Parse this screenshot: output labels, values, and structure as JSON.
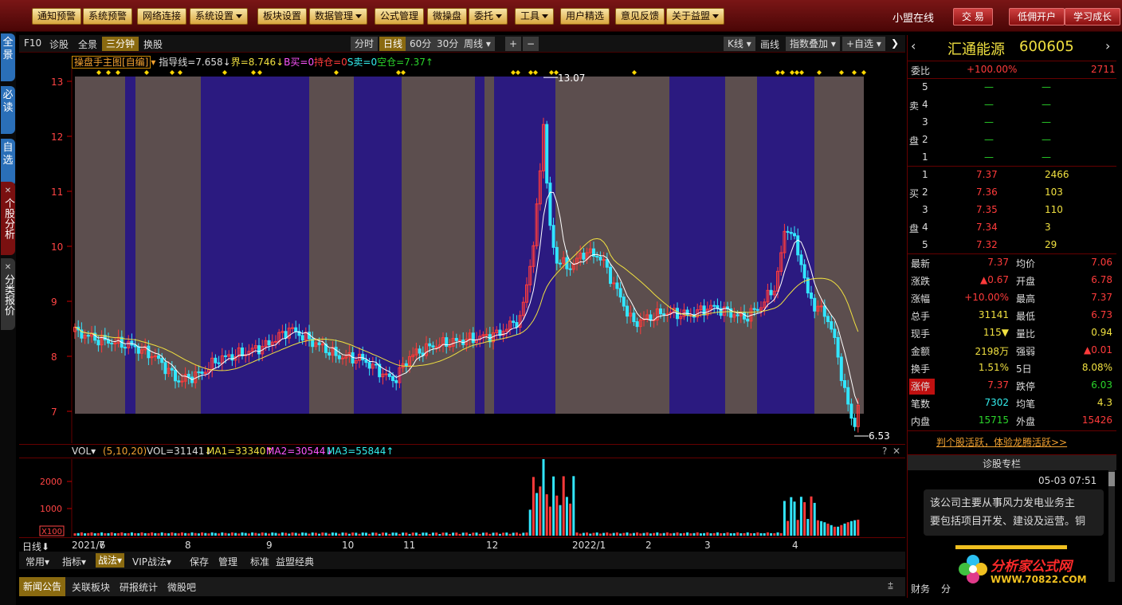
{
  "topbar": {
    "menu": [
      "通知预警",
      "系统预警",
      "网络连接",
      "系统设置",
      "板块设置",
      "数据管理",
      "公式管理",
      "微操盘",
      "委托",
      "工具",
      "用户精选",
      "意见反馈",
      "关于益盟"
    ],
    "user": "小盟在线",
    "actions": [
      "交 易",
      "低佣开户",
      "学习成长"
    ]
  },
  "lefttabs": [
    "全景",
    "必读",
    "自选",
    "个股分析",
    "分类报价"
  ],
  "toolbar": {
    "left": [
      "F10",
      "诊股",
      "全景",
      "三分钟",
      "换股"
    ],
    "periods": [
      "分时",
      "日线",
      "60分",
      "30分",
      "周线"
    ],
    "plus": "+",
    "minus": "−",
    "right": [
      "K线",
      "画线",
      "指数叠加",
      "+自选"
    ],
    "close": "❯"
  },
  "indicator": {
    "name": "操盘手主图[自编]",
    "line1": "指导线=7.658↓",
    "line2": "界=8.746↓",
    "line3": "B买=0",
    "line4": "持仓=0",
    "line5": "S卖=0",
    "line6": "空仓=7.37↑"
  },
  "chart": {
    "yticks": [
      "13",
      "12",
      "11",
      "10",
      "9",
      "8",
      "7"
    ],
    "high_label": "13.07",
    "low_label": "6.53",
    "xticks": [
      "2021/6",
      "7",
      "8",
      "9",
      "10",
      "11",
      "12",
      "2022/1",
      "2",
      "3",
      "4"
    ],
    "period_label": "日线",
    "colors": {
      "up": "#ff3b3b",
      "down": "#32e6ff",
      "band_buy": "#2b1a80",
      "band_hold": "#5c4e4e"
    }
  },
  "volume": {
    "header": "VOL",
    "params": "(5,10,20)",
    "vol": "VOL=31141↓",
    "ma1": "MA1=33340↑",
    "ma2": "MA2=30544↓",
    "ma3": "MA3=55844↑",
    "yticks": [
      "2000",
      "1000"
    ],
    "unit": "X100",
    "help": "?",
    "close": "✕"
  },
  "bottombar": [
    "常用",
    "指标",
    "战法",
    "VIP战法",
    "保存",
    "管理",
    "标准",
    "益盟经典"
  ],
  "newsbar": [
    "新闻公告",
    "关联板块",
    "研报统计",
    "微股吧"
  ],
  "stock": {
    "name": "汇通能源",
    "code": "600605",
    "weibi_label": "委比",
    "weibi": "+100.00%",
    "weicha": "2711",
    "sell_label": [
      "卖",
      "盘"
    ],
    "sells": [
      {
        "lvl": "5",
        "p": "—",
        "v": "—"
      },
      {
        "lvl": "4",
        "p": "—",
        "v": "—"
      },
      {
        "lvl": "3",
        "p": "—",
        "v": "—"
      },
      {
        "lvl": "2",
        "p": "—",
        "v": "—"
      },
      {
        "lvl": "1",
        "p": "—",
        "v": "—"
      }
    ],
    "buy_label": [
      "买",
      "盘"
    ],
    "buys": [
      {
        "lvl": "1",
        "p": "7.37",
        "v": "2466"
      },
      {
        "lvl": "2",
        "p": "7.36",
        "v": "103"
      },
      {
        "lvl": "3",
        "p": "7.35",
        "v": "110"
      },
      {
        "lvl": "4",
        "p": "7.34",
        "v": "3"
      },
      {
        "lvl": "5",
        "p": "7.32",
        "v": "29"
      }
    ],
    "quote": [
      [
        "最新",
        "7.37",
        "均价",
        "7.06"
      ],
      [
        "涨跌",
        "▲0.67",
        "开盘",
        "6.78"
      ],
      [
        "涨幅",
        "+10.00%",
        "最高",
        "7.37"
      ],
      [
        "总手",
        "31141",
        "最低",
        "6.73"
      ],
      [
        "现手",
        "115▼",
        "量比",
        "0.94"
      ],
      [
        "金额",
        "2198万",
        "强弱",
        "▲0.01"
      ],
      [
        "换手",
        "1.51%",
        "5日",
        "8.08%"
      ],
      [
        "涨停",
        "7.37",
        "跌停",
        "6.03"
      ],
      [
        "笔数",
        "7302",
        "均笔",
        "4.3"
      ],
      [
        "内盘",
        "15715",
        "外盘",
        "15426"
      ]
    ],
    "promo": "判个股活跃，体验龙腾活跃>>",
    "column_title": "诊股专栏",
    "column_time": "05-03 07:51",
    "column_text1": "该公司主要从事风力发电业务主",
    "column_text2": "要包括项目开发、建设及运营。铜",
    "tabs": [
      "财务",
      "分"
    ],
    "watermark1": "分析家公式网",
    "watermark2": "WWW.70822.COM"
  }
}
